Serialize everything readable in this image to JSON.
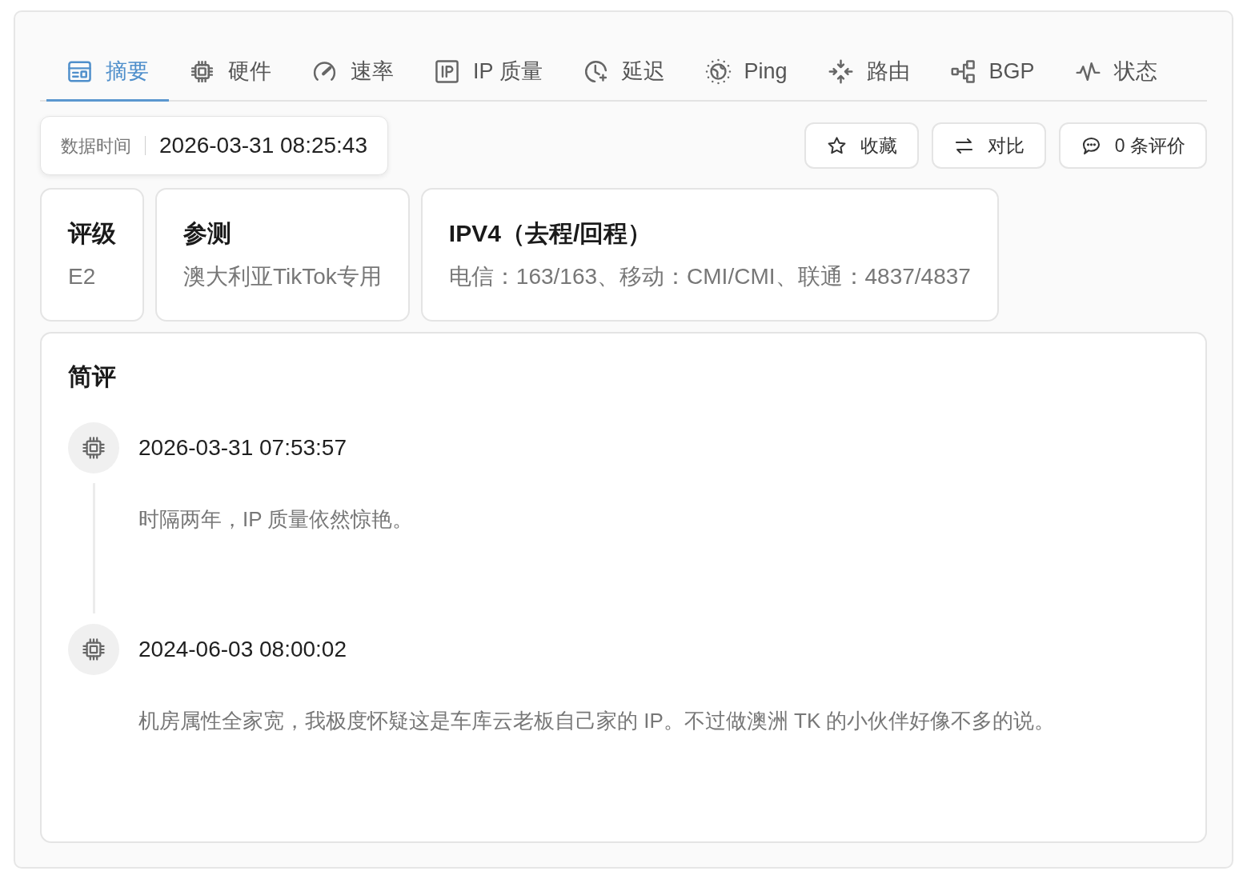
{
  "tabs": [
    {
      "label": "摘要",
      "selected": true
    },
    {
      "label": "硬件",
      "selected": false
    },
    {
      "label": "速率",
      "selected": false
    },
    {
      "label": "IP 质量",
      "selected": false
    },
    {
      "label": "延迟",
      "selected": false
    },
    {
      "label": "Ping",
      "selected": false
    },
    {
      "label": "路由",
      "selected": false
    },
    {
      "label": "BGP",
      "selected": false
    },
    {
      "label": "状态",
      "selected": false
    }
  ],
  "data_time": {
    "label": "数据时间",
    "value": "2026-03-31 08:25:43"
  },
  "actions": [
    "收藏",
    "对比",
    "0 条评价"
  ],
  "info_cards": [
    {
      "title": "评级",
      "value": "E2"
    },
    {
      "title": "参测",
      "value": "澳大利亚TikTok专用"
    },
    {
      "title": "IPV4（去程/回程）",
      "value": "电信：163/163、移动：CMI/CMI、联通：4837/4837"
    }
  ],
  "review": {
    "title": "简评",
    "entries": [
      {
        "time": "2026-03-31 07:53:57",
        "text": "时隔两年，IP 质量依然惊艳。"
      },
      {
        "time": "2024-06-03 08:00:02",
        "text": "机房属性全家宽，我极度怀疑这是车库云老板自己家的 IP。不过做澳洲 TK 的小伙伴好像不多的说。"
      }
    ]
  }
}
